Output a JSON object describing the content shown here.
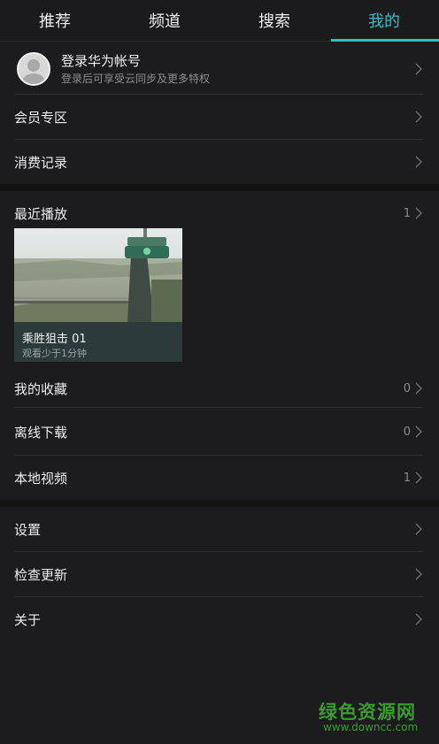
{
  "tabs": [
    {
      "label": "推荐"
    },
    {
      "label": "频道"
    },
    {
      "label": "搜索"
    },
    {
      "label": "我的"
    }
  ],
  "active_tab": "我的",
  "account": {
    "title": "登录华为帐号",
    "subtitle": "登录后可享受云同步及更多特权"
  },
  "section1": {
    "member": "会员专区",
    "purchases": "消费记录"
  },
  "recent": {
    "label": "最近播放",
    "count": "1",
    "item": {
      "title": "乘胜狙击 01",
      "subtitle": "观看少于1分钟"
    }
  },
  "library": {
    "favorites": {
      "label": "我的收藏",
      "count": "0"
    },
    "downloads": {
      "label": "离线下载",
      "count": "0"
    },
    "local": {
      "label": "本地视频",
      "count": "1"
    }
  },
  "section3": {
    "settings": "设置",
    "update": "检查更新",
    "about": "关于"
  },
  "watermark": {
    "cn": "绿色资源网",
    "en": "www.downcc.com"
  },
  "colors": {
    "accent": "#2dc1c7",
    "background": "#1c1c1e",
    "watermark": "#3a9a2e"
  }
}
